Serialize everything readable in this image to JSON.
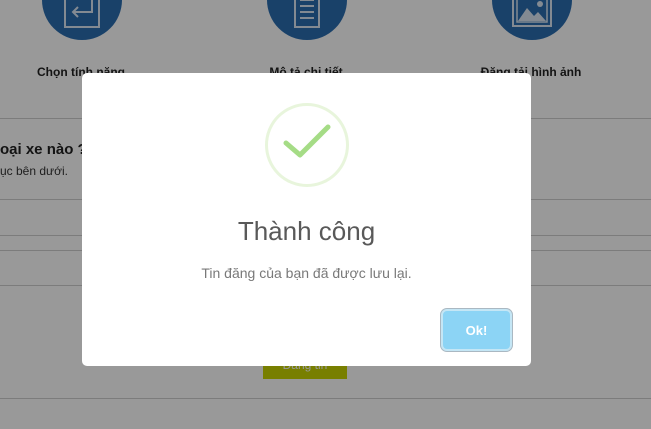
{
  "steps": [
    {
      "label": "Chọn tính năng",
      "icon": "enter-arrow-icon"
    },
    {
      "label": "Mô tả chi tiết",
      "icon": "document-lines-icon"
    },
    {
      "label": "Đăng tải hình ảnh",
      "icon": "image-icon"
    }
  ],
  "question": {
    "title": "oại xe nào ?",
    "subtitle": "ục bên dưới."
  },
  "page_button": {
    "label": "Đăng tin"
  },
  "modal": {
    "title": "Thành công",
    "message": "Tin đăng của bạn đã được lưu lại.",
    "ok_label": "Ok!",
    "icon": "checkmark-icon",
    "accent_color": "#a5dc86",
    "button_color": "#8cd4f5"
  },
  "colors": {
    "step_circle": "#2a6db0",
    "overlay": "rgba(0,0,0,0.4)",
    "page_button": "#c9d400"
  }
}
